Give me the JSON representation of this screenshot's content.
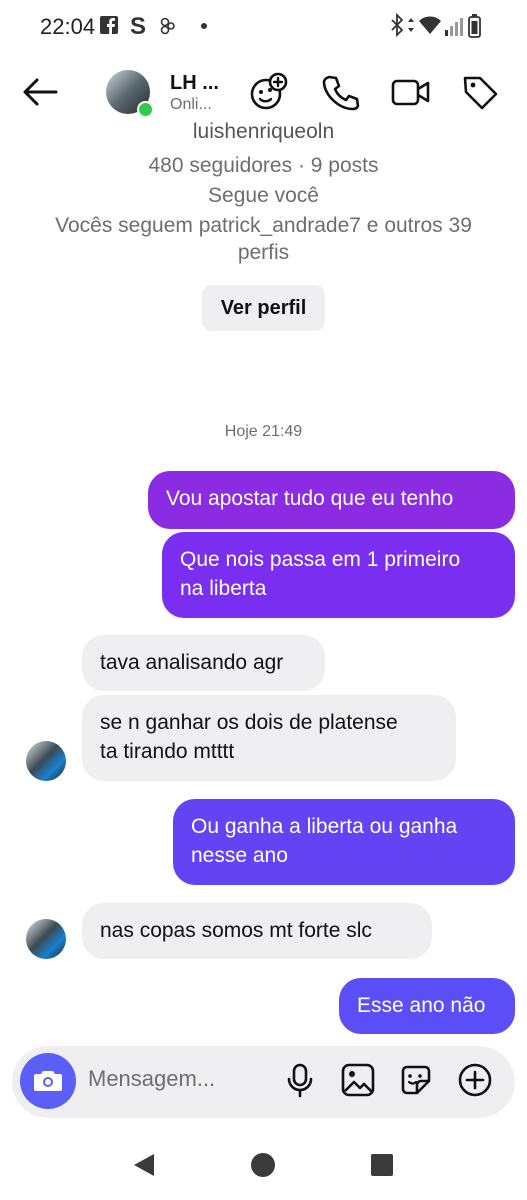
{
  "status_bar": {
    "time": "22:04",
    "left_icons": [
      "facebook-icon",
      "s-icon",
      "app-icon",
      "dot-icon"
    ],
    "right_icons": [
      "bluetooth-icon",
      "data-arrows-icon",
      "wifi-icon",
      "signal-icon",
      "battery-icon"
    ]
  },
  "header": {
    "name": "LH ...",
    "status": "Onli...",
    "actions": [
      "add-effect-icon",
      "phone-icon",
      "video-icon",
      "tag-icon"
    ]
  },
  "profile": {
    "username": "luishenriqueoln",
    "stats": "480 seguidores · 9 posts",
    "follows_you": "Segue você",
    "mutuals_line1": "Vocês seguem patrick_andrade7 e outros 39",
    "mutuals_line2": "perfis",
    "view_profile": "Ver perfil"
  },
  "thread": {
    "date": "Hoje 21:49",
    "messages": [
      {
        "dir": "out",
        "text": "Vou apostar tudo que eu tenho"
      },
      {
        "dir": "out",
        "text_line1": "Que nois passa em 1 primeiro",
        "text_line2": "na liberta"
      },
      {
        "dir": "in",
        "text": "tava analisando agr"
      },
      {
        "dir": "in",
        "text_line1": "se n ganhar os dois de platense",
        "text_line2": "ta tirando mtttt"
      },
      {
        "dir": "out",
        "text_line1": "Ou ganha a liberta ou ganha",
        "text_line2": "nesse ano"
      },
      {
        "dir": "in",
        "text": "nas copas somos mt forte slc"
      },
      {
        "dir": "out",
        "text": "Esse ano não"
      }
    ]
  },
  "composer": {
    "placeholder": "Mensagem..."
  },
  "colors": {
    "outgoing_top": "#8b2be2",
    "outgoing_bottom": "#5b4ef6",
    "incoming": "#efeff1",
    "camera": "#5b5ff6",
    "online": "#2fcc4b"
  }
}
